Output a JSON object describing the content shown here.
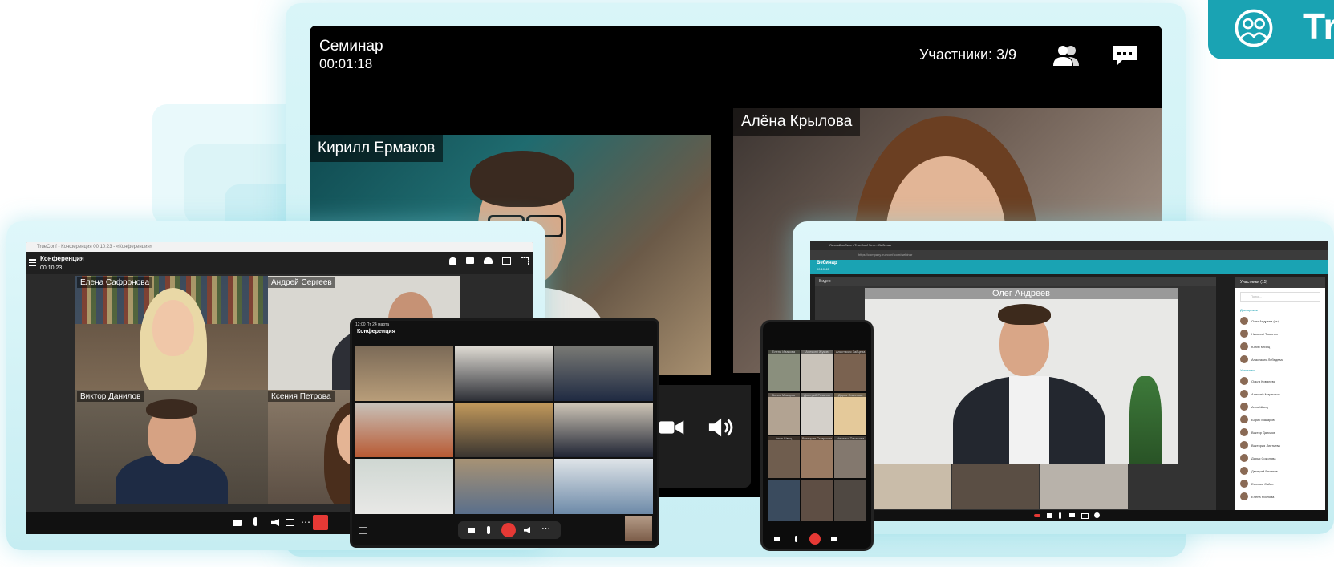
{
  "seminar": {
    "title": "Семинар",
    "timer": "00:01:18",
    "participants": "Участники: 3/9",
    "speaker_left": "Кирилл Ермаков",
    "speaker_right": "Алёна Крылова"
  },
  "conference": {
    "window_title": "TrueConf - Конференция 00:10:23 - «Конференция»",
    "title": "Конференция",
    "time": "00:10:23",
    "tiles": [
      "Елена Сафронова",
      "Андрей Сергеев",
      "Виктор Данилов",
      "Ксения Петрова"
    ]
  },
  "tablet": {
    "status": "12:00  Пт 24 марта",
    "title": "Конференция"
  },
  "phone": {
    "tiles": [
      "Елена Иванова",
      "Алексей Жуков",
      "Анастасия Зайцева",
      "Борис Макаров",
      "Дмитрий Рязанов",
      "Дарья Соколова",
      "Анна Швец",
      "Виктория Смирнова",
      "Наталья Тарасова"
    ]
  },
  "webinar": {
    "tabs": "Личный кабинет TrueConf Serv...   Вебинар",
    "url": "https://company.trueconf.com/webinar",
    "title": "Вебинар",
    "time": "00:10:42",
    "video_label": "Видео",
    "speaker": "Олег Андреев",
    "panel_title": "Участники (15)",
    "search": "Поиск...",
    "section_speakers": "Докладчики",
    "section_participants": "Участники",
    "speakers": [
      "Олег Андреев (вы)",
      "Николай Томилин",
      "Юлия Клинц",
      "Анастасия Лебедева"
    ],
    "participants": [
      "Ольга Ковалева",
      "Алексей Мартынов",
      "Анна Швец",
      "Борис Макаров",
      "Виктор Данилов",
      "Виктория Листьева",
      "Дарья Соколова",
      "Дмитрий Рязанов",
      "Евгения Сайко",
      "Елена Рослова"
    ]
  },
  "logo": {
    "text": "Tr"
  },
  "colors": {
    "accent": "#1aa3b3",
    "hangup": "#e53935",
    "glow": "#c9eef3"
  }
}
